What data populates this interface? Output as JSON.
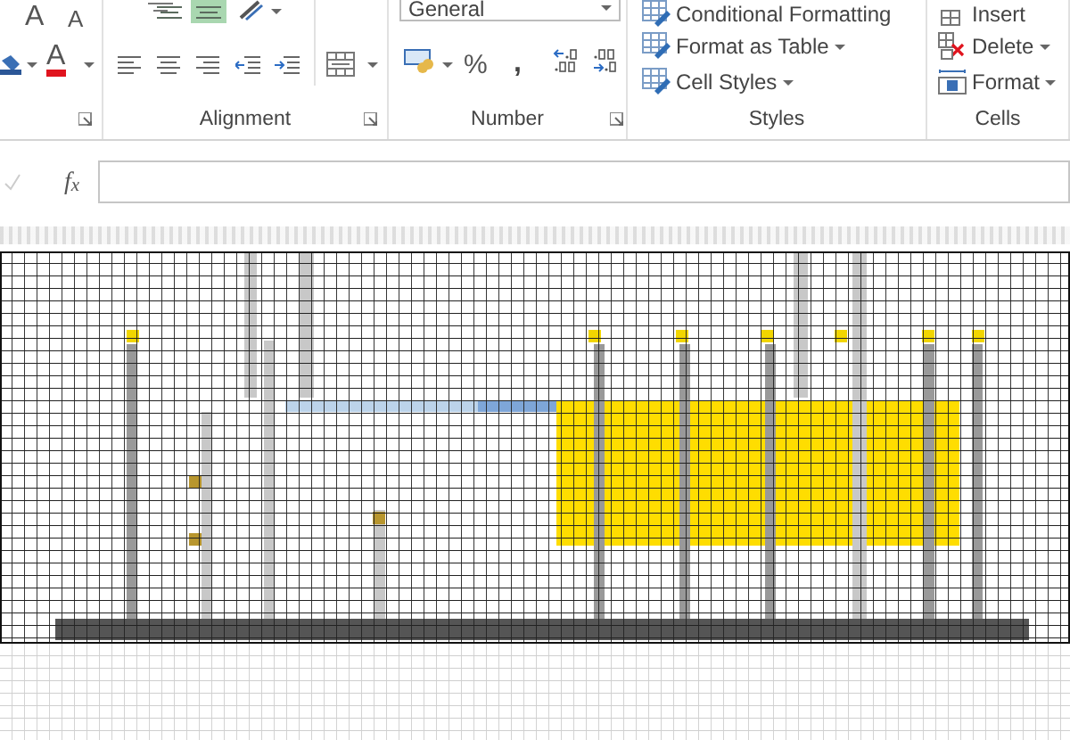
{
  "font_group": {
    "grow_font": "A",
    "shrink_font": "A",
    "font_color": "A"
  },
  "alignment_group": {
    "label": "Alignment",
    "vertical_align": [
      {
        "selected": false
      },
      {
        "selected": true
      }
    ]
  },
  "number_group": {
    "label": "Number",
    "format": "General",
    "percent": "%",
    "comma": ","
  },
  "styles_group": {
    "label": "Styles",
    "commands": [
      "Conditional Formatting",
      "Format as Table",
      "Cell Styles"
    ]
  },
  "cells_group": {
    "label": "Cells",
    "commands": [
      "Insert",
      "Delete",
      "Format"
    ]
  },
  "formula_bar": {
    "function_label": "f$_{x}$"
  }
}
